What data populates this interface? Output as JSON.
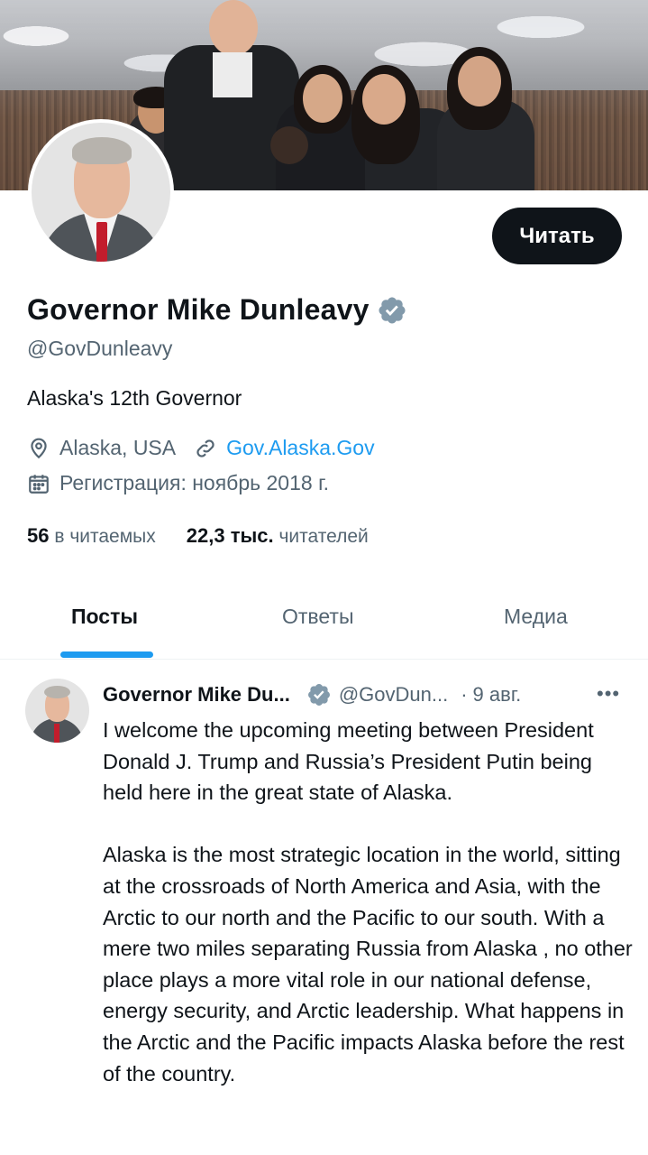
{
  "profile": {
    "follow_label": "Читать",
    "name": "Governor Mike Dunleavy",
    "handle": "@GovDunleavy",
    "bio": "Alaska's 12th Governor",
    "location": "Alaska, USA",
    "website": "Gov.Alaska.Gov",
    "joined": "Регистрация: ноябрь 2018 г.",
    "following_count": "56",
    "following_label": "в читаемых",
    "followers_count": "22,3 тыс.",
    "followers_label": "читателей"
  },
  "tabs": [
    {
      "label": "Посты",
      "active": true
    },
    {
      "label": "Ответы",
      "active": false
    },
    {
      "label": "Медиа",
      "active": false
    }
  ],
  "post": {
    "author_name": "Governor Mike Du...",
    "author_handle": "@GovDun...",
    "separator": "·",
    "date": "9 авг.",
    "more": "•••",
    "paragraph1": "I welcome the upcoming meeting between President Donald J. Trump and Russia’s President Putin being held here in the great state of Alaska.",
    "paragraph2": "Alaska is the most strategic location in the world, sitting at the crossroads of North America and Asia, with the Arctic to our north and the Pacific to our south. With a mere two miles separating Russia from Alaska , no other place plays a more vital role in our national defense, energy security, and Arctic leadership. What happens in the Arctic and the Pacific impacts Alaska before the rest of the country."
  },
  "icons": {
    "verified": "verified-badge-icon",
    "location": "location-pin-icon",
    "link": "link-icon",
    "calendar": "calendar-icon"
  },
  "colors": {
    "accent": "#1d9bf0",
    "text": "#0f1419",
    "muted": "#536471",
    "button": "#0f1419",
    "verified": "#829aab"
  }
}
